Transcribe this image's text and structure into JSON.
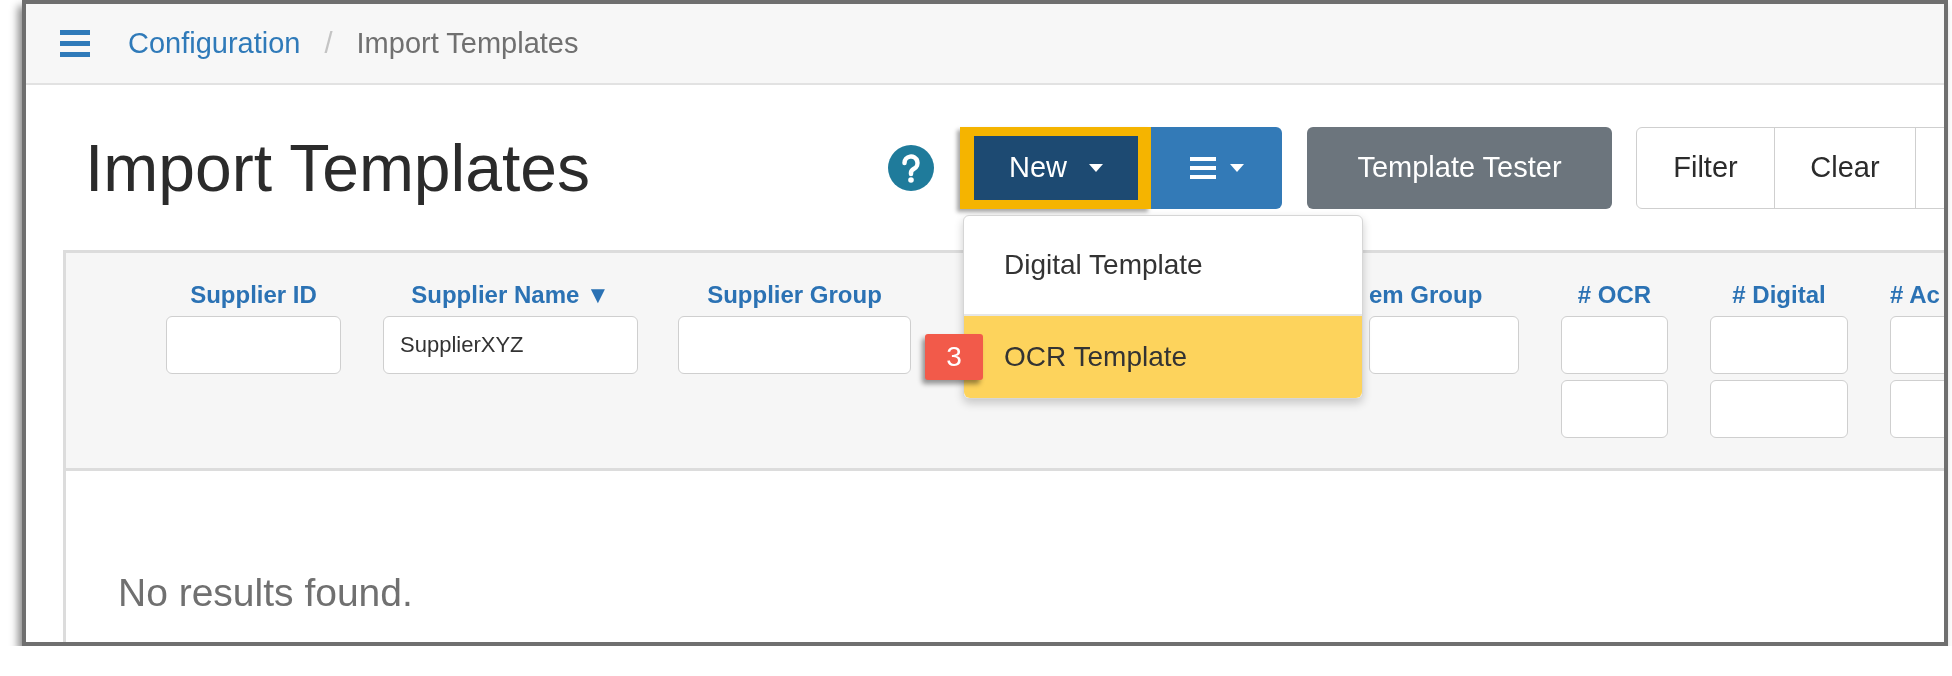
{
  "breadcrumb": {
    "items": [
      {
        "label": "Configuration",
        "kind": "link"
      },
      {
        "label": "Import Templates",
        "kind": "current"
      }
    ],
    "separator": "/"
  },
  "page_title": "Import Templates",
  "toolbar": {
    "new_button": {
      "label": "New",
      "highlighted": true
    },
    "template_tester": "Template Tester",
    "filter_buttons": [
      "Filter",
      "Clear"
    ]
  },
  "new_menu": {
    "items": [
      {
        "label": "Digital Template",
        "selected": false
      },
      {
        "label": "OCR Template",
        "selected": true
      }
    ],
    "step_badge": "3"
  },
  "filter_columns": [
    {
      "label": "Supplier ID",
      "fields": [
        {
          "kind": "text"
        }
      ]
    },
    {
      "label": "Supplier Name ▼",
      "fields": [
        {
          "kind": "text",
          "value": "SupplierXYZ"
        }
      ]
    },
    {
      "label": "Supplier Group",
      "fields": [
        {
          "kind": "text"
        }
      ]
    },
    {
      "label": "em Group",
      "fields": [
        {
          "kind": "text"
        }
      ]
    },
    {
      "label": "# OCR",
      "fields": [
        {
          "kind": "text"
        },
        {
          "kind": "text"
        }
      ]
    },
    {
      "label": "# Digital",
      "fields": [
        {
          "kind": "text"
        },
        {
          "kind": "text"
        }
      ]
    },
    {
      "label": "# Ac",
      "fields": [
        {
          "kind": "text"
        },
        {
          "kind": "text"
        }
      ]
    }
  ],
  "empty_message": "No results found."
}
